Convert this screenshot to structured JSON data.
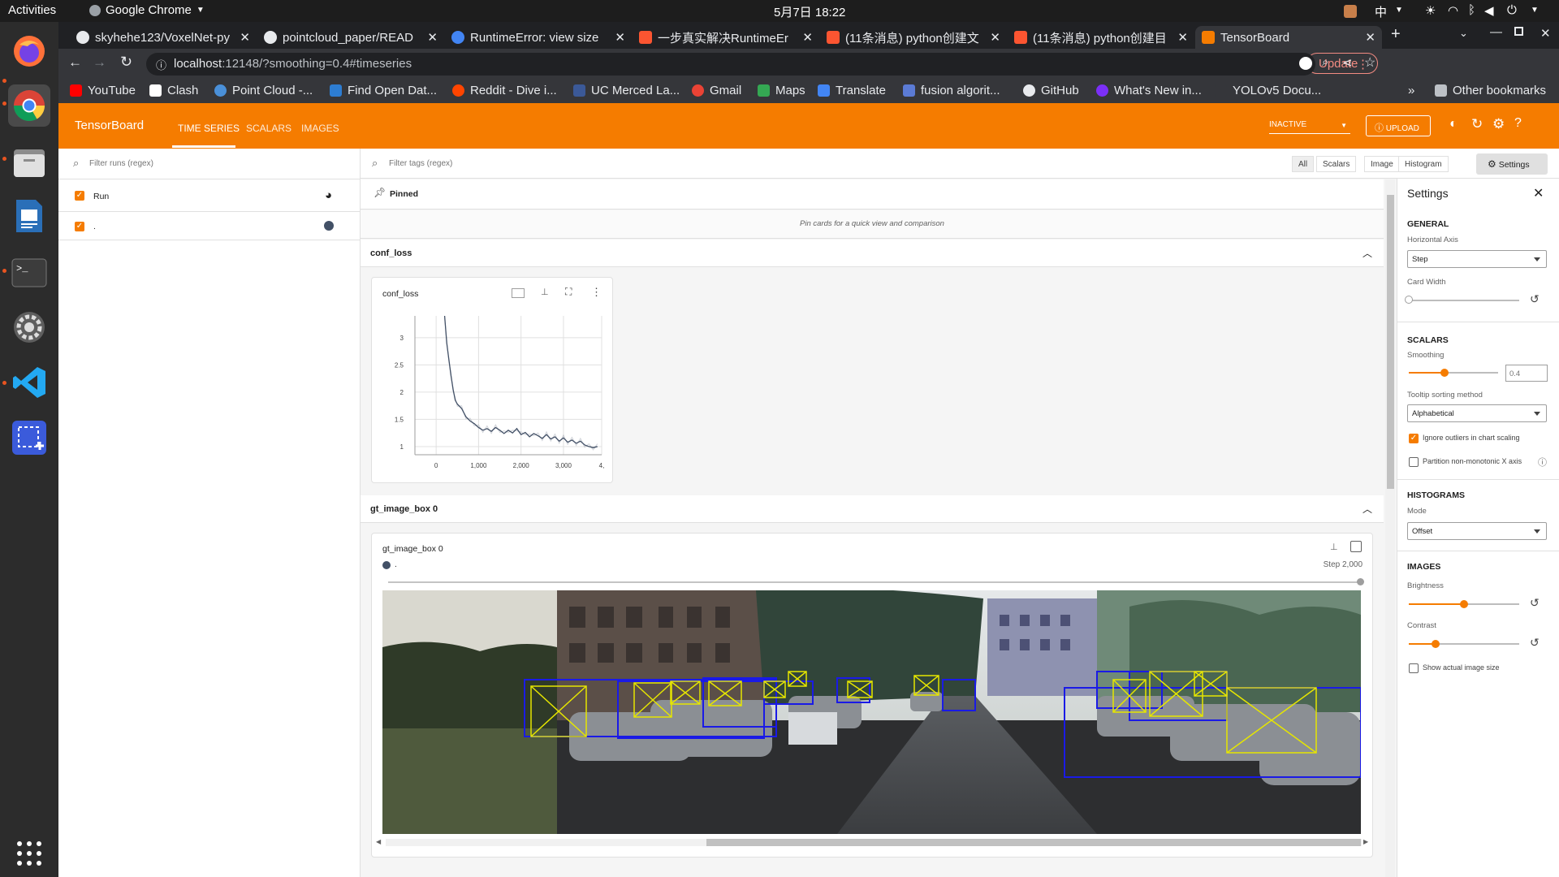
{
  "system": {
    "activities": "Activities",
    "app_name": "Google Chrome",
    "datetime": "5月7日  18:22",
    "input_method": "中"
  },
  "browser": {
    "tabs": [
      {
        "title": "skyhehe123/VoxelNet-py",
        "icon": "github-icon",
        "color": "#e8eaed"
      },
      {
        "title": "pointcloud_paper/READ",
        "icon": "github-icon",
        "color": "#e8eaed"
      },
      {
        "title": "RuntimeError: view size",
        "icon": "google-icon",
        "color": "#4285f4"
      },
      {
        "title": "一步真实解决RuntimeEr",
        "icon": "csdn-icon",
        "color": "#fc5531"
      },
      {
        "title": "(11条消息) python创建文",
        "icon": "csdn-icon",
        "color": "#fc5531"
      },
      {
        "title": "(11条消息) python创建目",
        "icon": "csdn-icon",
        "color": "#fc5531"
      },
      {
        "title": "TensorBoard",
        "icon": "tensorboard-icon",
        "color": "#f57c00"
      }
    ],
    "url_host": "localhost",
    "url_rest": ":12148/?smoothing=0.4#timeseries",
    "profile_initial": "月",
    "update_label": "Update",
    "bookmarks": [
      {
        "label": "YouTube",
        "color": "#ff0000"
      },
      {
        "label": "Clash",
        "color": "#ffffff"
      },
      {
        "label": "Point Cloud -...",
        "color": "#4a90d9"
      },
      {
        "label": "Find Open Dat...",
        "color": "#2d7dd2"
      },
      {
        "label": "Reddit - Dive i...",
        "color": "#ff4500"
      },
      {
        "label": "UC Merced La...",
        "color": "#3b5998"
      },
      {
        "label": "Gmail",
        "color": "#ea4335"
      },
      {
        "label": "Maps",
        "color": "#34a853"
      },
      {
        "label": "Translate",
        "color": "#4285f4"
      },
      {
        "label": "fusion algorit...",
        "color": "#5b7bd5"
      },
      {
        "label": "GitHub",
        "color": "#e8eaed"
      },
      {
        "label": "What's New in...",
        "color": "#7b2ff7"
      },
      {
        "label": "YOLOv5 Docu...",
        "color": "#35363a"
      }
    ],
    "more_bookmarks": "»",
    "other_bookmarks": "Other bookmarks"
  },
  "tensorboard": {
    "brand": "TensorBoard",
    "nav": [
      "TIME SERIES",
      "SCALARS",
      "IMAGES"
    ],
    "status": "INACTIVE",
    "upload": "UPLOAD",
    "runs_filter_placeholder": "Filter runs (regex)",
    "runs_header": "Run",
    "run_name": ".",
    "run_color": "#425066",
    "tags_filter_placeholder": "Filter tags (regex)",
    "tag_filters": [
      "All",
      "Scalars",
      "Image",
      "Histogram"
    ],
    "settings_button": "Settings",
    "pinned_label": "Pinned",
    "pinned_hint": "Pin cards for a quick view and comparison",
    "group1": "conf_loss",
    "card1_title": "conf_loss",
    "group2": "gt_image_box 0",
    "card2_title": "gt_image_box 0",
    "card2_run": ".",
    "card2_step": "Step 2,000"
  },
  "settings": {
    "title": "Settings",
    "general": "GENERAL",
    "horizontal_axis_label": "Horizontal Axis",
    "horizontal_axis_value": "Step",
    "card_width_label": "Card Width",
    "card_width": 0,
    "scalars": "SCALARS",
    "smoothing_label": "Smoothing",
    "smoothing_value": "0.4",
    "tooltip_label": "Tooltip sorting method",
    "tooltip_value": "Alphabetical",
    "ignore_outliers": "Ignore outliers in chart scaling",
    "ignore_outliers_checked": true,
    "partition_label": "Partition non-monotonic X axis",
    "partition_checked": false,
    "histograms": "HISTOGRAMS",
    "mode_label": "Mode",
    "mode_value": "Offset",
    "images": "IMAGES",
    "brightness_label": "Brightness",
    "brightness": 0.5,
    "contrast_label": "Contrast",
    "contrast": 0.24,
    "actual_size_label": "Show actual image size",
    "actual_size_checked": false
  },
  "chart_data": {
    "type": "line",
    "title": "conf_loss",
    "xlabel": "",
    "ylabel": "",
    "xlim": [
      -500,
      3900
    ],
    "ylim": [
      0.85,
      3.4
    ],
    "x_ticks": [
      "0",
      "1,000",
      "2,000",
      "3,000",
      "4,"
    ],
    "x_tick_values": [
      0,
      1000,
      2000,
      3000,
      3900
    ],
    "y_ticks": [
      "1",
      "1.5",
      "2",
      "2.5",
      "3"
    ],
    "y_tick_values": [
      1,
      1.5,
      2,
      2.5,
      3
    ],
    "grid": true,
    "series": [
      {
        "name": ".",
        "color": "#425066",
        "x": [
          200,
          250,
          300,
          350,
          400,
          450,
          500,
          600,
          700,
          800,
          900,
          1000,
          1100,
          1200,
          1300,
          1400,
          1500,
          1600,
          1700,
          1800,
          1900,
          2000,
          2100,
          2200,
          2300,
          2400,
          2500,
          2600,
          2700,
          2800,
          2900,
          3000,
          3100,
          3200,
          3300,
          3400,
          3500,
          3600,
          3700,
          3800
        ],
        "y": [
          3.4,
          2.9,
          2.6,
          2.3,
          2.05,
          1.85,
          1.78,
          1.7,
          1.55,
          1.47,
          1.42,
          1.35,
          1.3,
          1.33,
          1.28,
          1.35,
          1.3,
          1.24,
          1.3,
          1.25,
          1.33,
          1.22,
          1.26,
          1.18,
          1.24,
          1.2,
          1.15,
          1.22,
          1.14,
          1.18,
          1.1,
          1.16,
          1.08,
          1.12,
          1.06,
          1.1,
          1.03,
          1.0,
          0.98,
          1.0
        ]
      }
    ]
  }
}
